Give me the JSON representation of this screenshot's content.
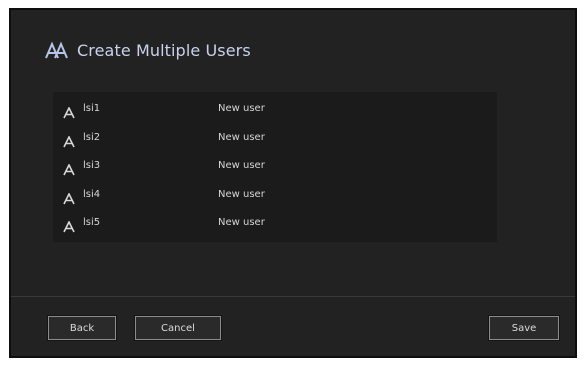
{
  "dialog": {
    "title": "Create Multiple Users",
    "title_icon": "users-icon"
  },
  "users": [
    {
      "name": "lsi1",
      "role": "New user",
      "icon": "user-icon"
    },
    {
      "name": "lsi2",
      "role": "New user",
      "icon": "user-icon"
    },
    {
      "name": "lsi3",
      "role": "New user",
      "icon": "user-icon"
    },
    {
      "name": "lsi4",
      "role": "New user",
      "icon": "user-icon"
    },
    {
      "name": "lsi5",
      "role": "New user",
      "icon": "user-icon"
    }
  ],
  "buttons": {
    "back": "Back",
    "cancel": "Cancel",
    "save": "Save"
  },
  "colors": {
    "background": "#222222",
    "list_background": "#1b1b1b",
    "title": "#c8d2ee",
    "text": "#d6d6d6"
  }
}
